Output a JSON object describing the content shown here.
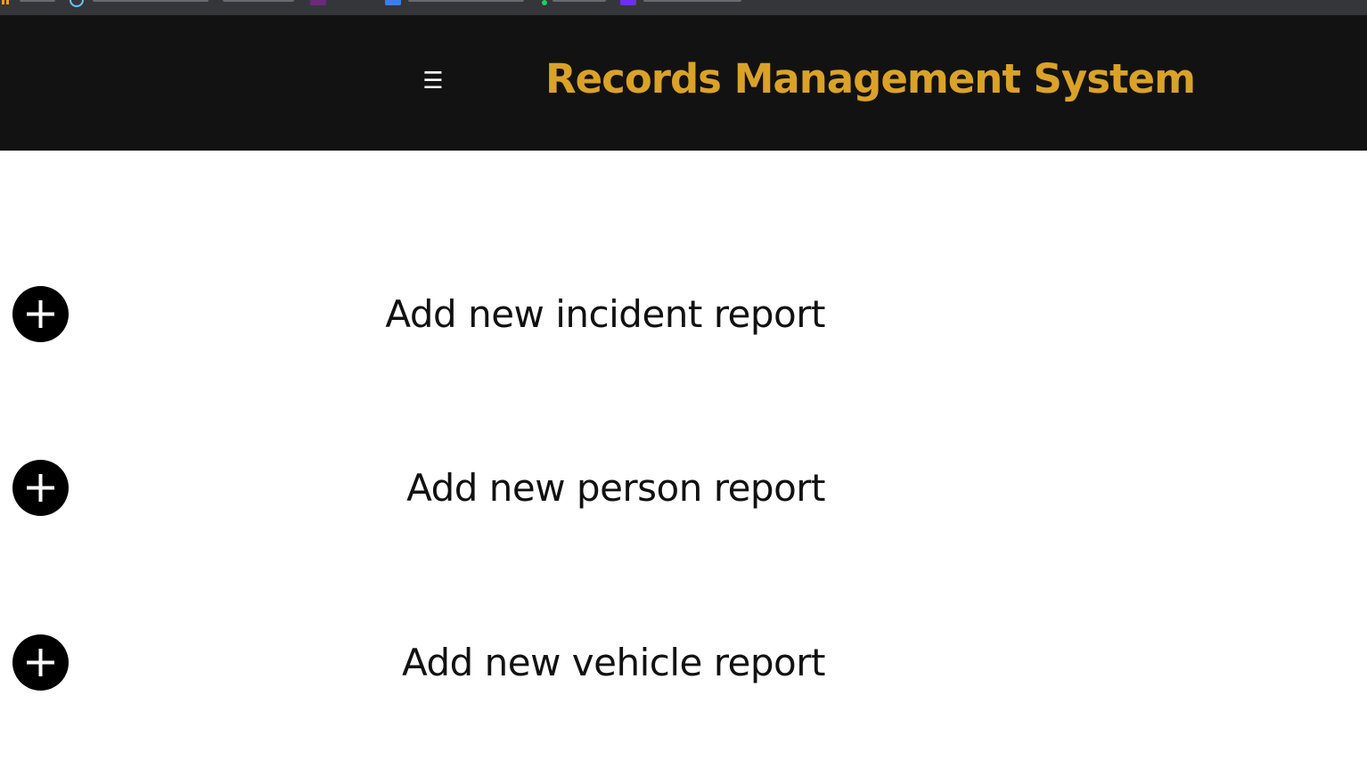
{
  "header": {
    "title": "Records Management System",
    "menu_icon": "☰",
    "background": "#121212",
    "title_color": "#dba228"
  },
  "actions": [
    {
      "label": "Add new incident report",
      "icon": "plus-circle-icon"
    },
    {
      "label": "Add new person report",
      "icon": "plus-circle-icon"
    },
    {
      "label": "Add new vehicle report",
      "icon": "plus-circle-icon"
    }
  ]
}
